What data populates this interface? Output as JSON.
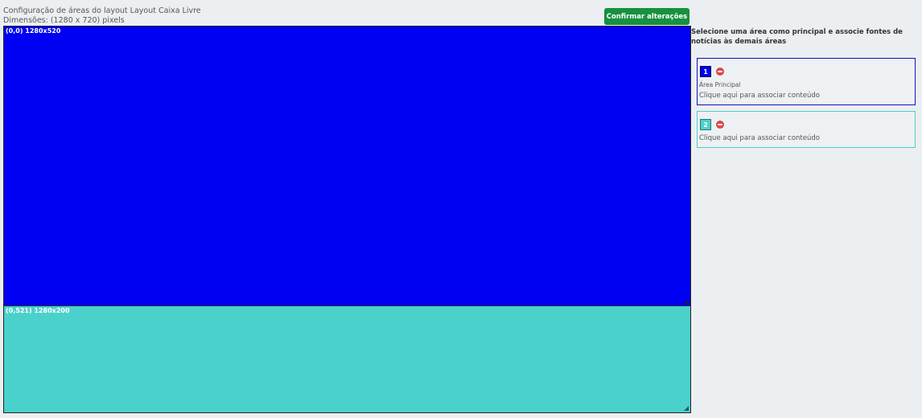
{
  "header": {
    "title": "Configuração de áreas do layout Layout Caixa Livre",
    "dimensions": "Dimensões: (1280 x 720) pixels",
    "confirm_label": "Confirmar alterações"
  },
  "canvas": {
    "areas": [
      {
        "id": "1",
        "label": "(0,0) 1280x520",
        "color": "#0000f2"
      },
      {
        "id": "2",
        "label": "(0,521) 1280x200",
        "color": "#4ad1cc"
      }
    ]
  },
  "sidebar": {
    "instructions": "Selecione uma área como principal e associe fontes de notícias às demais áreas",
    "cards": [
      {
        "number": "1",
        "badge_color": "#0000f2",
        "main_label": "Área Principal",
        "link": "Clique aqui para associar conteúdo"
      },
      {
        "number": "2",
        "badge_color": "#4ad1cc",
        "link": "Clique aqui para associar conteúdo"
      }
    ]
  },
  "colors": {
    "accent_green": "#16913f",
    "remove_red": "#e54747"
  },
  "icons": {
    "remove": "remove-circle-icon",
    "resize": "resize-handle-icon"
  }
}
